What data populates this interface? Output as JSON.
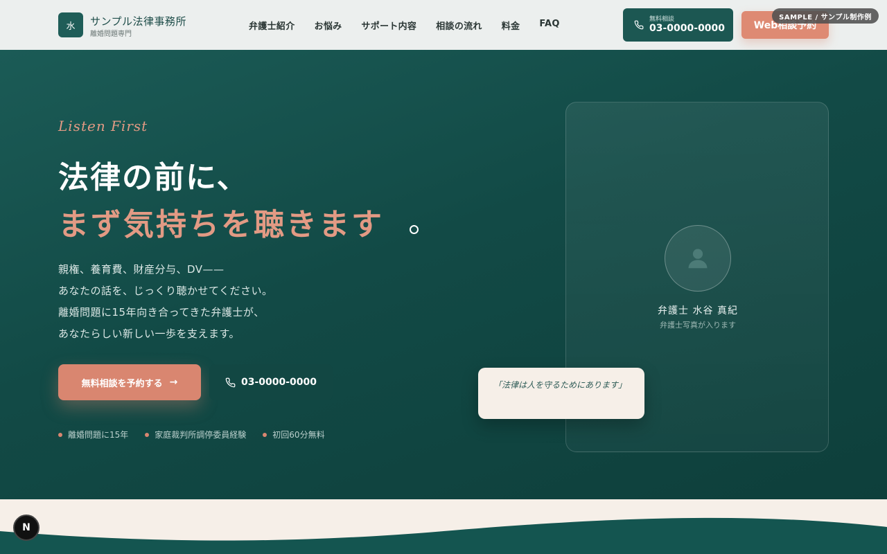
{
  "brand": {
    "mark": "水",
    "name": "サンプル法律事務所",
    "subtitle": "離婚問題専門"
  },
  "nav": {
    "items": [
      {
        "label": "弁護士紹介"
      },
      {
        "label": "お悩み"
      },
      {
        "label": "サポート内容"
      },
      {
        "label": "相談の流れ"
      },
      {
        "label": "料金"
      },
      {
        "label": "FAQ"
      }
    ]
  },
  "header_tel": {
    "label": "無料相談",
    "number": "03-0000-0000"
  },
  "web_button": {
    "label": "Web相談予約"
  },
  "sample_badge": "SAMPLE / サンプル制作例",
  "hero": {
    "eyebrow": "Listen First",
    "title_line1": "法律の前に、",
    "title_line2": "まず気持ちを聴きます",
    "lead": [
      "親権、養育費、財産分与、DV——",
      "あなたの話を、じっくり聴かせてください。",
      "離婚問題に15年向き合ってきた弁護士が、",
      "あなたらしい新しい一歩を支えます。"
    ],
    "cta_primary": "無料相談を予約する",
    "cta_tel": "03-0000-0000",
    "features": [
      {
        "label": "離婚問題に15年"
      },
      {
        "label": "家庭裁判所調停委員経験"
      },
      {
        "label": "初回60分無料"
      }
    ]
  },
  "lawyer_card": {
    "name": "弁護士 水谷 真紀",
    "photo_note": "弁護士写真が入ります",
    "quote": "「法律は人を守るためにあります」"
  },
  "corner_badge": "N",
  "colors": {
    "primary": "#1c5752",
    "accent": "#de8a73",
    "header_bg": "#ecefee",
    "cream": "#f6efe8"
  },
  "icons": [
    "phone-icon",
    "arrow-right-icon",
    "person-icon"
  ]
}
